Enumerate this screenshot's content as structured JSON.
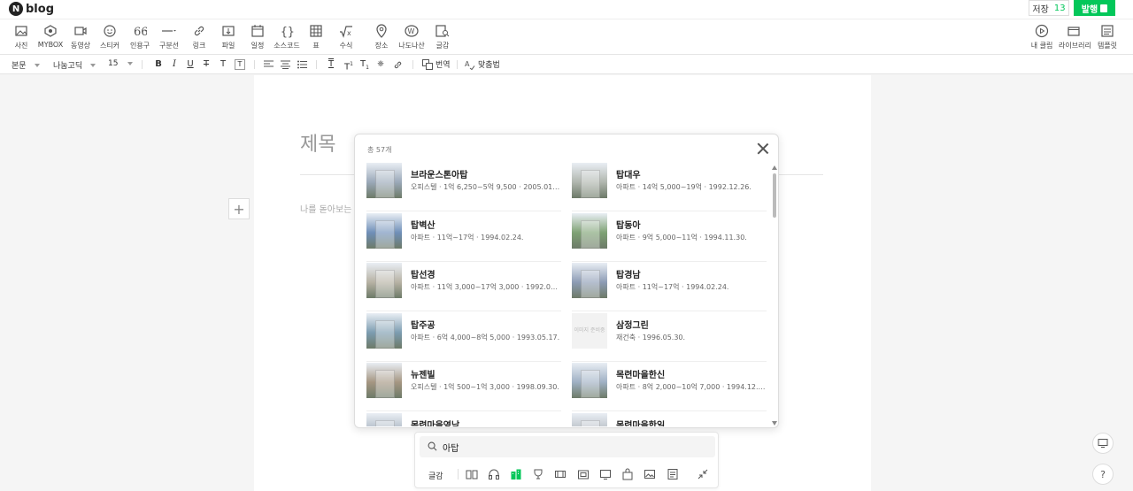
{
  "app": {
    "logo_letter": "N",
    "logo_text": "blog"
  },
  "header": {
    "save_label": "저장",
    "save_count": "13",
    "publish_label": "발행"
  },
  "toolbar": {
    "items": [
      {
        "label": "사진",
        "icon": "image-icon"
      },
      {
        "label": "MYBOX",
        "icon": "mybox-icon"
      },
      {
        "label": "동영상",
        "icon": "video-icon"
      },
      {
        "label": "스티커",
        "icon": "smile-icon"
      },
      {
        "label": "인용구",
        "icon": "quote-icon"
      },
      {
        "label": "구분선",
        "icon": "divider-icon"
      },
      {
        "label": "링크",
        "icon": "link-icon"
      },
      {
        "label": "파일",
        "icon": "file-icon"
      },
      {
        "label": "일정",
        "icon": "calendar-icon"
      },
      {
        "label": "소스코드",
        "icon": "code-icon"
      },
      {
        "label": "표",
        "icon": "table-icon"
      },
      {
        "label": "수식",
        "icon": "formula-icon"
      },
      {
        "label": "장소",
        "icon": "map-pin-icon"
      },
      {
        "label": "나도나산",
        "icon": "profile-icon"
      },
      {
        "label": "글감",
        "icon": "search-doc-icon"
      }
    ],
    "right_items": [
      {
        "label": "내 클립",
        "icon": "play-icon"
      },
      {
        "label": "라이브러리",
        "icon": "library-icon"
      },
      {
        "label": "템플릿",
        "icon": "template-icon"
      }
    ]
  },
  "format": {
    "style": "본문",
    "font": "나눔고딕",
    "size": "15",
    "translate_label": "번역",
    "spell_label": "맞춤법"
  },
  "editor": {
    "title_placeholder": "제목",
    "body_placeholder": "나를 돋아보는"
  },
  "popup": {
    "total": "총 57개",
    "no_image_text": "이미지\n준비중",
    "items": [
      {
        "name": "브라운스톤아탑",
        "meta": "오피스텔 · 1억 6,250~5억 9,500 · 2005.01....",
        "has_image": true,
        "color": "#9aa8b8"
      },
      {
        "name": "탑대우",
        "meta": "아파트 · 14억 5,000~19억 · 1992.12.26.",
        "has_image": true,
        "color": "#b0b6ae"
      },
      {
        "name": "탑벽산",
        "meta": "아파트 · 11억~17억 · 1994.02.24.",
        "has_image": true,
        "color": "#6f8fb8"
      },
      {
        "name": "탑동아",
        "meta": "아파트 · 9억 5,000~11억 · 1994.11.30.",
        "has_image": true,
        "color": "#7fa274"
      },
      {
        "name": "탑선경",
        "meta": "아파트 · 11억 3,000~17억 3,000 · 1992.08....",
        "has_image": true,
        "color": "#b7b2a4"
      },
      {
        "name": "탑경남",
        "meta": "아파트 · 11억~17억 · 1994.02.24.",
        "has_image": true,
        "color": "#8d9cb5"
      },
      {
        "name": "탑주공",
        "meta": "아파트 · 6억 4,000~8억 5,000 · 1993.05.17.",
        "has_image": true,
        "color": "#7c9cb0"
      },
      {
        "name": "삼정그린",
        "meta": "재건축 · 1996.05.30.",
        "has_image": false,
        "color": "#f2f2f2"
      },
      {
        "name": "뉴젠빌",
        "meta": "오피스텔 · 1억 500~1억 3,000 · 1998.09.30.",
        "has_image": true,
        "color": "#a59682"
      },
      {
        "name": "목련마을한신",
        "meta": "아파트 · 8억 2,000~10억 7,000 · 1994.12.2...",
        "has_image": true,
        "color": "#9fb0c4"
      },
      {
        "name": "목련마을영남",
        "meta": "",
        "has_image": true,
        "color": "#a8b3bf"
      },
      {
        "name": "목련마을한일",
        "meta": "",
        "has_image": true,
        "color": "#b3b9c0"
      }
    ]
  },
  "search": {
    "query": "아탑",
    "category_label": "글감",
    "categories": [
      "book-icon",
      "headphones-icon",
      "building-icon",
      "trophy-icon",
      "ticket-icon",
      "tv-icon",
      "monitor-icon",
      "bag-icon",
      "image-icon",
      "doc-icon"
    ]
  },
  "colors": {
    "accent": "#03c75a"
  }
}
